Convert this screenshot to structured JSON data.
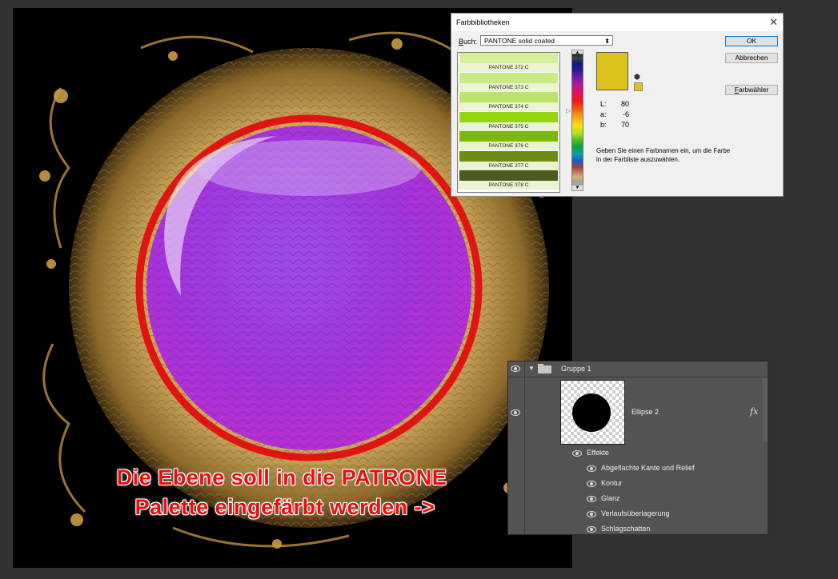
{
  "canvas": {
    "caption_line1": "Die Ebene soll in die PATRONE",
    "caption_line2": "Palette eingefärbt werden ->",
    "ring_color": "#e11414",
    "purple_color": "#a63ce0"
  },
  "dialog": {
    "title": "Farbbibliotheken",
    "close_icon": "close-icon",
    "book_label_prefix": "B",
    "book_label_rest": "uch:",
    "book_value": "PANTONE solid coated",
    "swatches": [
      {
        "name": "PANTONE 372 C",
        "color": "#d6ef9a"
      },
      {
        "name": "PANTONE 373 C",
        "color": "#c7ea83"
      },
      {
        "name": "PANTONE 374 C",
        "color": "#b9e46a"
      },
      {
        "name": "PANTONE 375 C",
        "color": "#93d50f"
      },
      {
        "name": "PANTONE 376 C",
        "color": "#7ab80a"
      },
      {
        "name": "PANTONE 377 C",
        "color": "#6b8e12"
      },
      {
        "name": "PANTONE 378 C",
        "color": "#4b5a1e"
      }
    ],
    "current_color": "#dcc31e",
    "lab": {
      "L_label": "L:",
      "L": "80",
      "a_label": "a:",
      "a": "-6",
      "b_label": "b:",
      "b": "70"
    },
    "info": "Geben Sie einen Farbnamen ein, um die Farbe in der Farbliste auszuwählen.",
    "buttons": {
      "ok": "OK",
      "cancel": "Abbrechen",
      "picker": "Farbwähler"
    }
  },
  "layers": {
    "group_name": "Gruppe 1",
    "layer_name": "Ellipse 2",
    "fx_label": "fx",
    "effects_label": "Effekte",
    "effects": [
      "Abgeflachte Kante und Relief",
      "Kontur",
      "Glanz",
      "Verlaufsüberlagerung",
      "Schlagschatten"
    ]
  }
}
